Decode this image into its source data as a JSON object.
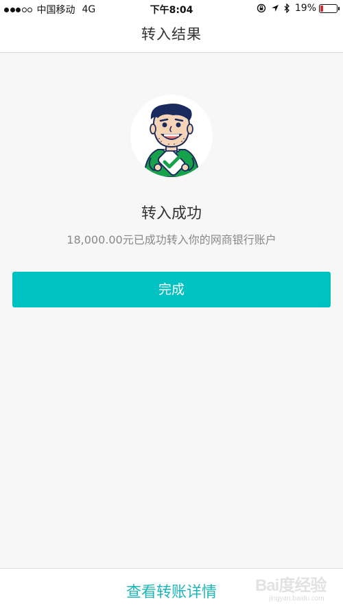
{
  "status_bar": {
    "signal_dots": [
      true,
      true,
      true,
      false,
      false
    ],
    "carrier": "中国移动",
    "network": "4G",
    "time": "下午8:04",
    "battery_percent": "19%",
    "battery_level": 0.19,
    "battery_color": "#e0262d",
    "icons": [
      "rotation-lock-icon",
      "location-arrow-icon",
      "bluetooth-icon"
    ]
  },
  "nav": {
    "title": "转入结果"
  },
  "result": {
    "title": "转入成功",
    "description": "18,000.00元已成功转入你的网商银行账户"
  },
  "actions": {
    "done_label": "完成",
    "done_color": "#00c2c2",
    "detail_link_label": "查看转账详情",
    "detail_link_color": "#1cb5b8"
  },
  "watermark": {
    "brand": "Bai度经验",
    "url": "jingyan.baidu.com"
  }
}
